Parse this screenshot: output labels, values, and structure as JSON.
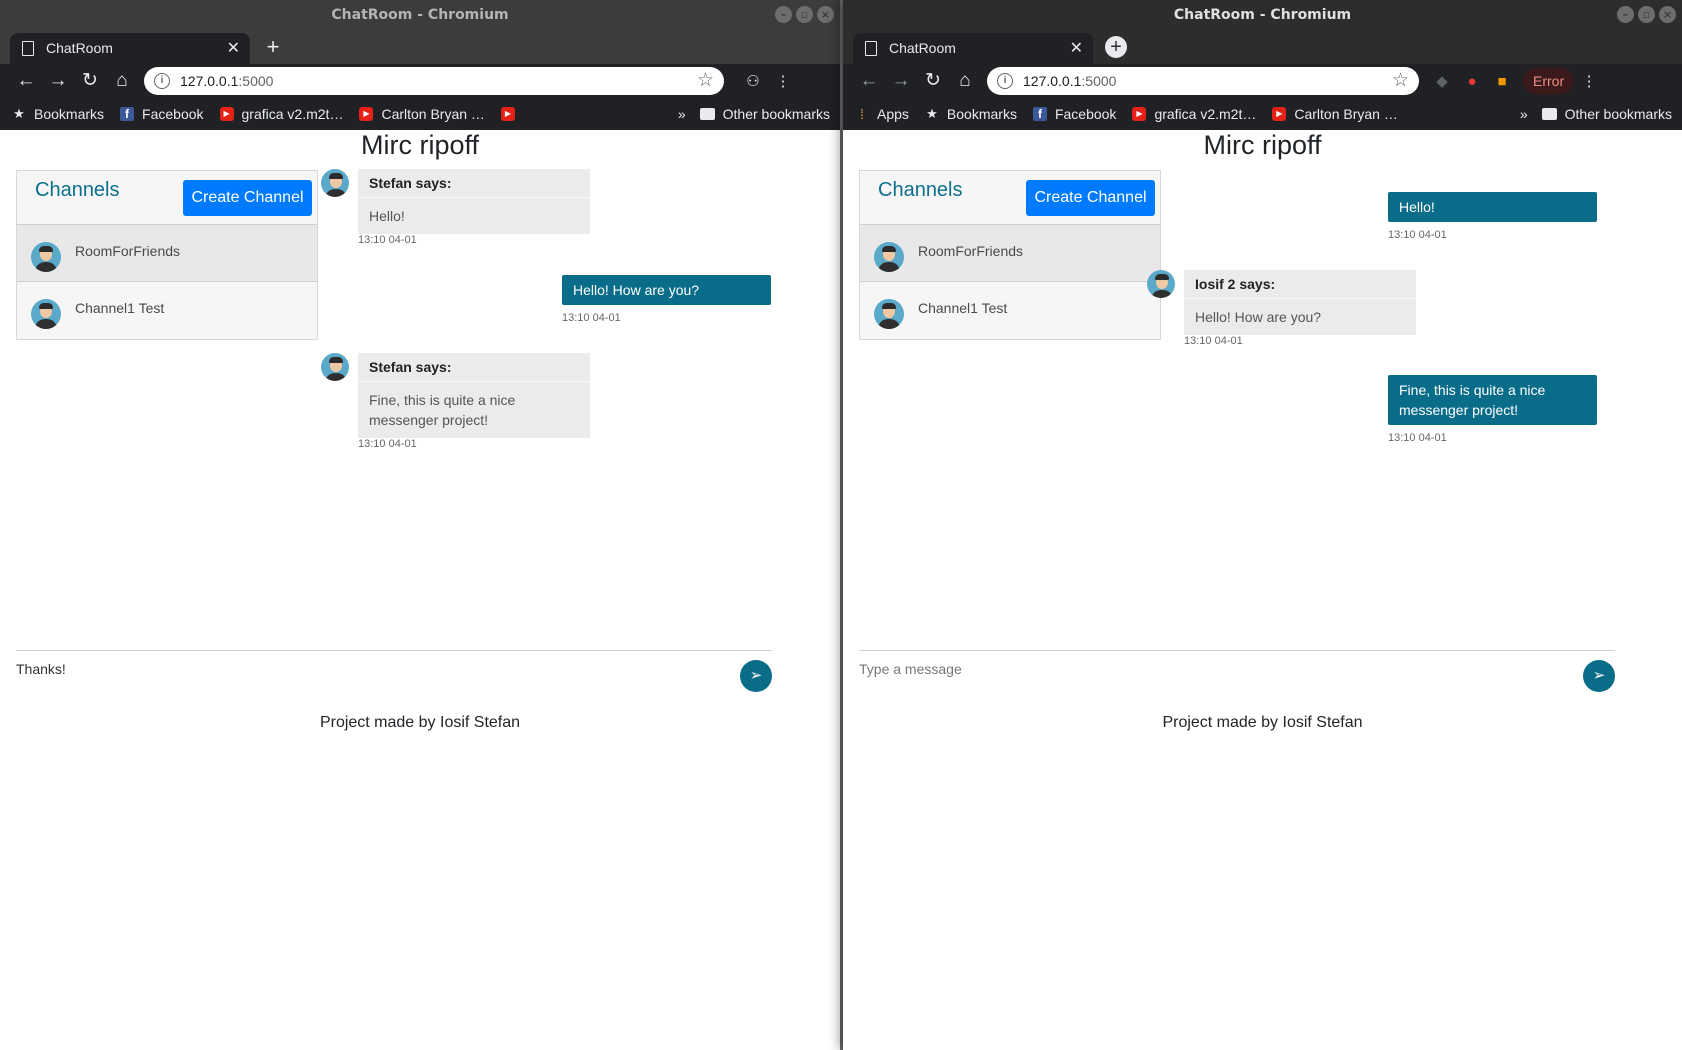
{
  "left": {
    "window_title": "ChatRoom - Chromium",
    "tab_title": "ChatRoom",
    "url_host": "127.0.0.1",
    "url_port": ":5000",
    "bookmarks": [
      "Bookmarks",
      "Facebook",
      "grafica v2.m2t…",
      "Carlton Bryan …",
      "Other bookmarks"
    ],
    "page_title": "Mirc ripoff",
    "sidebar_title": "Channels",
    "create_channel": "Create Channel",
    "channels": [
      "RoomForFriends",
      "Channel1 Test"
    ],
    "messages": {
      "m1": {
        "sender": "Stefan says:",
        "text": "Hello!",
        "time": "13:10 04-01"
      },
      "m2": {
        "text": "Hello! How are you?",
        "time": "13:10 04-01"
      },
      "m3": {
        "sender": "Stefan says:",
        "text": "Fine, this is quite a nice messenger project!",
        "time": "13:10 04-01"
      }
    },
    "composer_value": "Thanks!",
    "footer": "Project made by Iosif Stefan"
  },
  "right": {
    "window_title": "ChatRoom - Chromium",
    "tab_title": "ChatRoom",
    "url_host": "127.0.0.1",
    "url_port": ":5000",
    "error_label": "Error",
    "bookmarks": [
      "Apps",
      "Bookmarks",
      "Facebook",
      "grafica v2.m2t…",
      "Carlton Bryan …",
      "Other bookmarks"
    ],
    "page_title": "Mirc ripoff",
    "sidebar_title": "Channels",
    "create_channel": "Create Channel",
    "channels": [
      "RoomForFriends",
      "Channel1 Test"
    ],
    "messages": {
      "m1": {
        "text": "Hello!",
        "time": "13:10 04-01"
      },
      "m2": {
        "sender": "Iosif 2 says:",
        "text": "Hello! How are you?",
        "time": "13:10 04-01"
      },
      "m3": {
        "text": "Fine, this is quite a nice messenger project!",
        "time": "13:10 04-01"
      }
    },
    "composer_placeholder": "Type a message",
    "footer": "Project made by Iosif Stefan"
  },
  "colors": {
    "accent": "#096c88",
    "primary_button": "#007bff",
    "channel_title": "#0c6f8d"
  },
  "icons": [
    "back-arrow-icon",
    "forward-arrow-icon",
    "reload-icon",
    "home-icon",
    "star-icon",
    "menu-icon",
    "send-icon",
    "avatar-icon",
    "folder-icon"
  ]
}
